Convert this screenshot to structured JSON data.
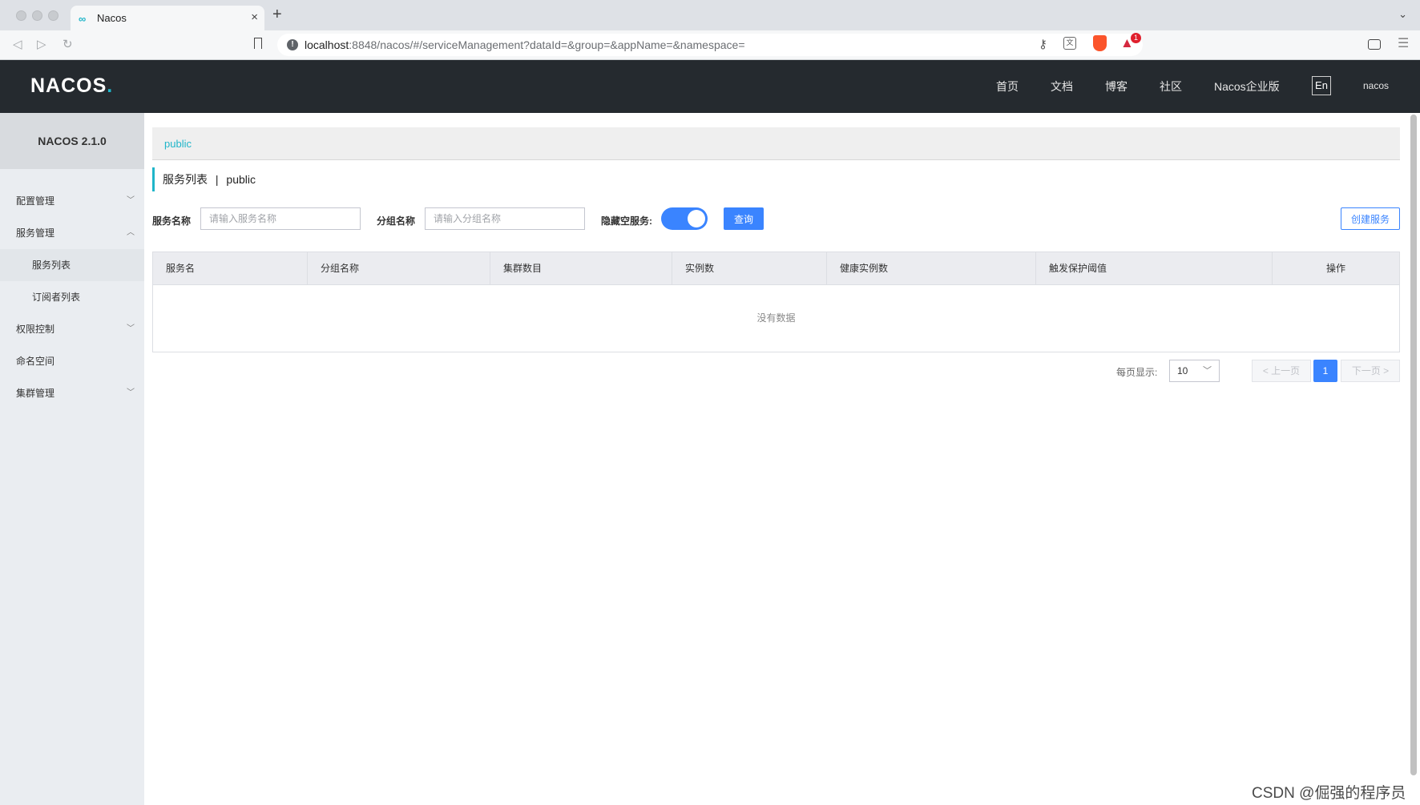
{
  "browser": {
    "tab_title": "Nacos",
    "url_host": "localhost",
    "url_rest": ":8848/nacos/#/serviceManagement?dataId=&group=&appName=&namespace=",
    "rewards_badge": "1"
  },
  "header": {
    "logo_main": "NACOS",
    "logo_dot": ".",
    "menu": [
      "首页",
      "文档",
      "博客",
      "社区",
      "Nacos企业版"
    ],
    "lang": "En",
    "user": "nacos"
  },
  "sidebar": {
    "title": "NACOS 2.1.0",
    "items": [
      {
        "label": "配置管理"
      },
      {
        "label": "服务管理"
      },
      {
        "label": "服务列表"
      },
      {
        "label": "订阅者列表"
      },
      {
        "label": "权限控制"
      },
      {
        "label": "命名空间"
      },
      {
        "label": "集群管理"
      }
    ]
  },
  "main": {
    "namespace_link": "public",
    "page_title": "服务列表",
    "title_separator": "|",
    "page_namespace": "public",
    "service_name_label": "服务名称",
    "service_name_placeholder": "请输入服务名称",
    "group_name_label": "分组名称",
    "group_name_placeholder": "请输入分组名称",
    "hide_empty_label": "隐藏空服务:",
    "hide_empty_on": true,
    "query_label": "查询",
    "create_label": "创建服务",
    "columns": [
      "服务名",
      "分组名称",
      "集群数目",
      "实例数",
      "健康实例数",
      "触发保护阈值",
      "操作"
    ],
    "empty_text": "没有数据",
    "pager": {
      "per_page_label": "每页显示:",
      "per_page_value": "10",
      "prev_label": "< 上一页",
      "current_page": "1",
      "next_label": "下一页 >"
    }
  },
  "watermark": "CSDN @倔强的程序员",
  "colors": {
    "accent": "#1fb5c9",
    "primary": "#3a84ff",
    "header_bg": "#252a2f"
  }
}
